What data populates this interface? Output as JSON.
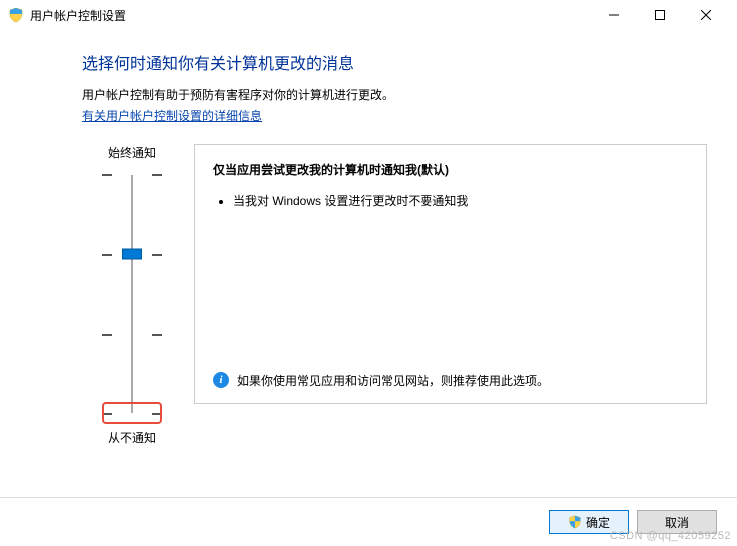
{
  "window": {
    "title": "用户帐户控制设置"
  },
  "page": {
    "heading": "选择何时通知你有关计算机更改的消息",
    "description": "用户帐户控制有助于预防有害程序对你的计算机进行更改。",
    "link": "有关用户帐户控制设置的详细信息"
  },
  "slider": {
    "top_label": "始终通知",
    "bottom_label": "从不通知",
    "levels": 4,
    "selected_index": 1
  },
  "detail": {
    "title": "仅当应用尝试更改我的计算机时通知我(默认)",
    "bullets": [
      "当我对 Windows 设置进行更改时不要通知我"
    ],
    "recommendation": "如果你使用常见应用和访问常见网站，则推荐使用此选项。"
  },
  "buttons": {
    "ok": "确定",
    "cancel": "取消"
  },
  "watermark": "CSDN @qq_42059252"
}
